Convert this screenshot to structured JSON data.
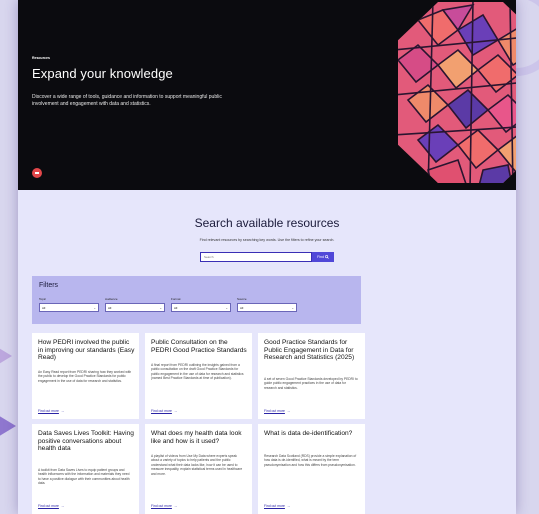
{
  "hero": {
    "eyebrow": "Resources",
    "title": "Expand your knowledge",
    "description": "Discover a wide range of tools, guidance and information to support meaningful public involvement and engagement with data and statistics."
  },
  "search": {
    "heading": "Search available resources",
    "subtitle": "Find relevant resources by searching key words. Use the filters to refine your search.",
    "placeholder": "Search",
    "button_label": "Find"
  },
  "filters": {
    "title": "Filters",
    "items": [
      {
        "label": "Topic",
        "value": "All"
      },
      {
        "label": "Audience",
        "value": "All"
      },
      {
        "label": "Format",
        "value": "All"
      },
      {
        "label": "Source",
        "value": "All"
      }
    ]
  },
  "cards": [
    {
      "title": "How PEDRI involved the public in improving our standards (Easy Read)",
      "description": "An Easy Read report from PEDRI sharing how they worked with the public to develop the Good Practice Standards for public engagement in the use of data for research and statistics.",
      "link": "Find out more"
    },
    {
      "title": "Public Consultation on the PEDRI Good Practice Standards",
      "description": "A final report from PEDRI outlining the insights gained from a public consultation on the draft Good Practice Standards for public engagement in the use of data for research and statistics (named Best Practice Standards at time of publication).",
      "link": "Find out more"
    },
    {
      "title": "Good Practice Standards for Public Engagement in Data for Research and Statistics (2025)",
      "description": "A set of seven Good Practice Standards developed by PEDRI to guide public engagement practices in the use of data for research and statistics.",
      "link": "Find out more"
    },
    {
      "title": "Data Saves Lives Toolkit: Having positive conversations about health data",
      "description": "A toolkit from Data Saves Lives to equip patient groups and health influencers with the information and materials they need to have a positive dialogue with their communities about health data.",
      "link": "Find out more"
    },
    {
      "title": "What does my health data look like and how is it used?",
      "description": "A playlist of videos from Use My Data where experts speak about a variety of topics to help patients and the public understand what their data looks like, how it can be used to measure inequality, explain statistical terms used in healthcare and more.",
      "link": "Find out more"
    },
    {
      "title": "What is data de-identification?",
      "description": "Research Data Scotland (RDS) provide a simple explanation of how data is de-identified, what is meant by the term pseudonymisation and how this differs from pseudonymisation.",
      "link": "Find out more"
    }
  ]
}
